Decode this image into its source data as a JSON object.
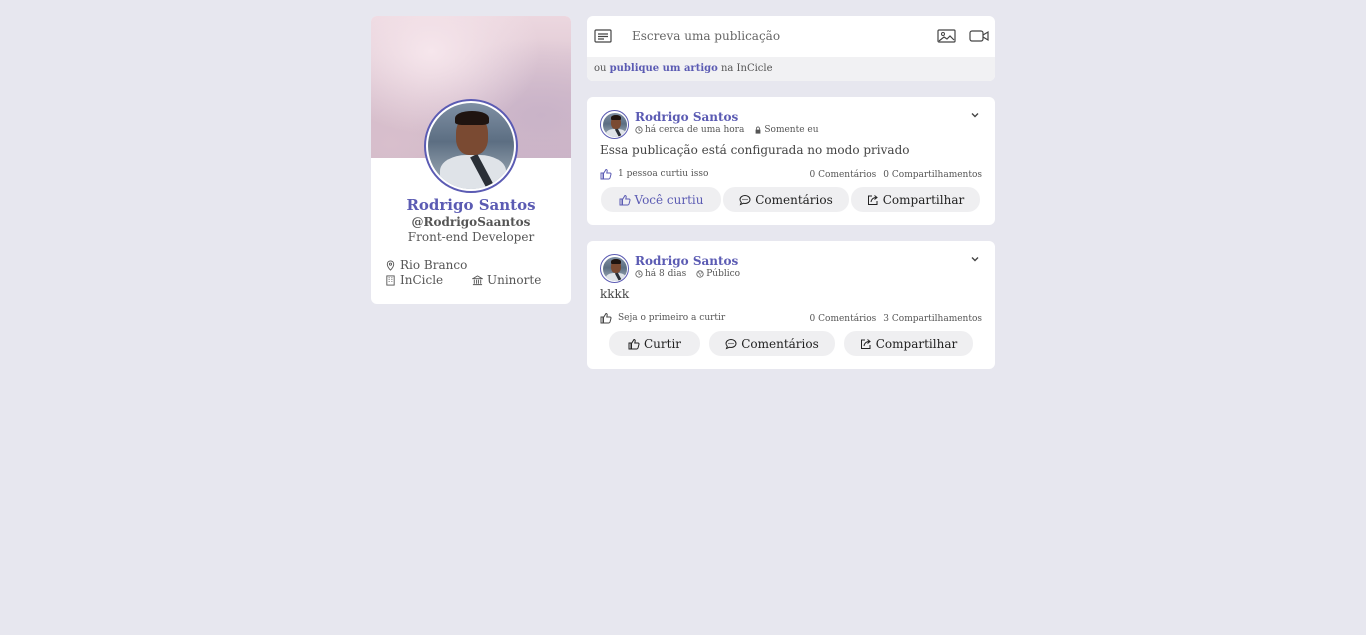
{
  "profile": {
    "name": "Rodrigo Santos",
    "handle": "@RodrigoSaantos",
    "role": "Front-end Developer",
    "location": "Rio Branco",
    "company": "InCicle",
    "institution": "Uninorte"
  },
  "composer": {
    "placeholder": "Escreva uma publicação",
    "footer_prefix": "ou",
    "footer_link": "publique um artigo",
    "footer_suffix": "na InCicle"
  },
  "posts": [
    {
      "author": "Rodrigo Santos",
      "time": "há cerca de uma hora",
      "visibility": "Somente eu",
      "text": "Essa publicação está configurada no modo privado",
      "like_summary": "1 pessoa curtiu isso",
      "comments_count": "0 Comentários",
      "shares_count": "0 Compartilhamentos",
      "like_label": "Você curtiu",
      "comment_label": "Comentários",
      "share_label": "Compartilhar"
    },
    {
      "author": "Rodrigo Santos",
      "time": "há 8 dias",
      "visibility": "Público",
      "text": "kkkk",
      "like_summary": "Seja o primeiro a curtir",
      "comments_count": "0 Comentários",
      "shares_count": "3 Compartilhamentos",
      "like_label": "Curtir",
      "comment_label": "Comentários",
      "share_label": "Compartilhar"
    }
  ],
  "colors": {
    "accent": "#5b5bb3",
    "background": "#e7e7ef",
    "button_bg": "#efeff1"
  },
  "icons": [
    "location-icon",
    "building-icon",
    "institution-icon",
    "text-post-icon",
    "image-icon",
    "video-icon",
    "clock-icon",
    "lock-icon",
    "globe-icon",
    "chevron-down-icon",
    "thumbs-up-icon",
    "comment-icon",
    "share-icon"
  ]
}
